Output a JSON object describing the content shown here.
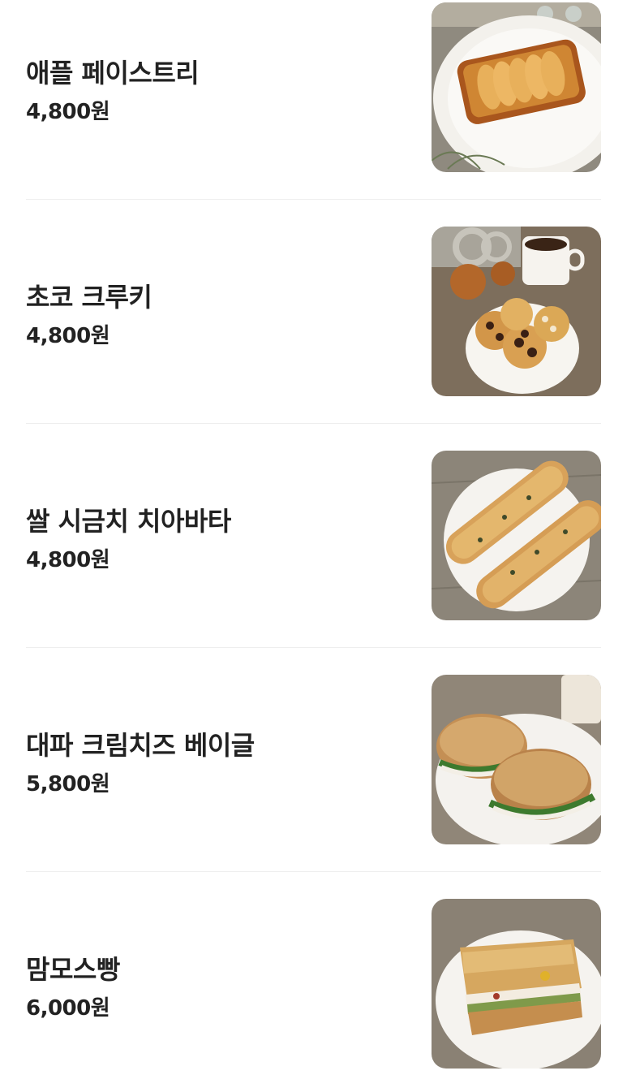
{
  "menu": {
    "items": [
      {
        "name": "애플 페이스트리",
        "price": "4,800원",
        "image": "apple-pastry-photo"
      },
      {
        "name": "초코 크루키",
        "price": "4,800원",
        "image": "choco-crookie-photo"
      },
      {
        "name": "쌀 시금치 치아바타",
        "price": "4,800원",
        "image": "rice-spinach-ciabatta-photo"
      },
      {
        "name": "대파 크림치즈 베이글",
        "price": "5,800원",
        "image": "green-onion-cream-cheese-bagel-photo"
      },
      {
        "name": "맘모스빵",
        "price": "6,000원",
        "image": "mammoth-bread-photo"
      }
    ]
  },
  "colors": {
    "text": "#222222",
    "divider": "#eeeeee",
    "background": "#ffffff"
  }
}
